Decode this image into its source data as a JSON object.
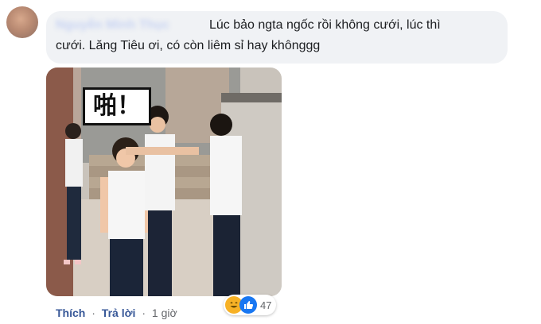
{
  "comment": {
    "author": "Nguyễn Minh Thục",
    "text_line1": "Lúc bảo ngta ngốc rồi không cưới, lúc thì",
    "text_line2": "cưới. Lăng Tiêu ơi, có còn liêm sỉ hay khônggg",
    "image": {
      "caption_text": "啪！",
      "icon": "comment-photo"
    },
    "actions": {
      "like": "Thích",
      "reply": "Trả lời",
      "separator": "·",
      "time": "1 giờ"
    },
    "reactions": {
      "icons": [
        "haha-icon",
        "like-icon"
      ],
      "count": "47",
      "colors": {
        "like": "#1877f2",
        "haha": "#f7b125"
      }
    }
  },
  "colors": {
    "bubble": "#f0f2f5",
    "link": "#385898",
    "meta": "#65676b",
    "text": "#1c1e21"
  }
}
